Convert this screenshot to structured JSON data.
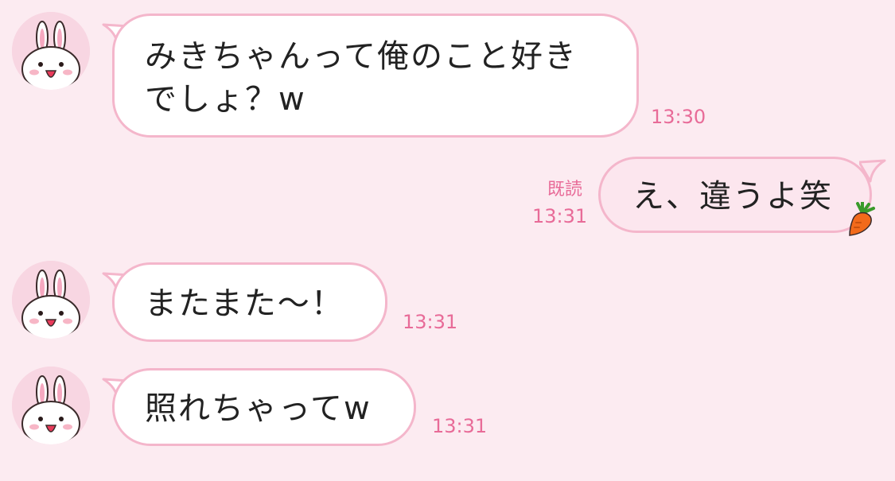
{
  "colors": {
    "background": "#fcebf1",
    "bubble_border": "#f4b6cb",
    "outgoing_bubble": "#fce6ee",
    "accent_text": "#e86b98"
  },
  "messages": [
    {
      "direction": "incoming",
      "avatar": "bunny-avatar",
      "text_line1": "みきちゃんって俺のこと好き",
      "text_line2": "でしょ？w",
      "time": "13:30"
    },
    {
      "direction": "outgoing",
      "read_label": "既読",
      "text": "え、違うよ笑",
      "sticker": "carrot-icon",
      "time": "13:31"
    },
    {
      "direction": "incoming",
      "avatar": "bunny-avatar",
      "text": "またまた〜！",
      "time": "13:31"
    },
    {
      "direction": "incoming",
      "avatar": "bunny-avatar",
      "text": "照れちゃってw",
      "time": "13:31"
    }
  ]
}
